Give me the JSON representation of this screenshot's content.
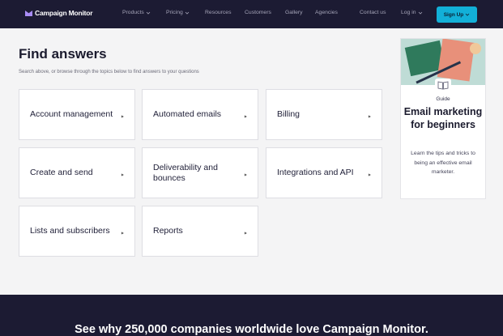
{
  "nav": {
    "brand": "Campaign Monitor",
    "items": [
      {
        "label": "Products",
        "dropdown": true
      },
      {
        "label": "Pricing",
        "dropdown": true
      },
      {
        "label": "Resources",
        "dropdown": false
      },
      {
        "label": "Customers",
        "dropdown": false
      },
      {
        "label": "Gallery",
        "dropdown": false
      },
      {
        "label": "Agencies",
        "dropdown": false
      },
      {
        "label": "Contact us",
        "dropdown": false
      },
      {
        "label": "Log in",
        "dropdown": true
      }
    ],
    "signup_label": "Sign Up",
    "colors": {
      "bar": "#1c1b33",
      "signup": "#12b0d8",
      "logo_accent": "#a98cf5"
    }
  },
  "main": {
    "title": "Find answers",
    "subtitle": "Search above, or browse through the topics below to find answers to your questions",
    "topics": [
      {
        "label": "Account management"
      },
      {
        "label": "Automated emails"
      },
      {
        "label": "Billing"
      },
      {
        "label": "Create and send"
      },
      {
        "label": "Deliverability and bounces"
      },
      {
        "label": "Integrations and API"
      },
      {
        "label": "Lists and subscribers"
      },
      {
        "label": "Reports"
      }
    ],
    "arrow_icon": "chevron-right-icon"
  },
  "guide": {
    "tag": "Guide",
    "title": "Email marketing for beginners",
    "description": "Learn the tips and tricks to being an effective email marketer.",
    "icon": "book-icon"
  },
  "footer": {
    "text": "See why 250,000 companies worldwide love Campaign Monitor."
  }
}
